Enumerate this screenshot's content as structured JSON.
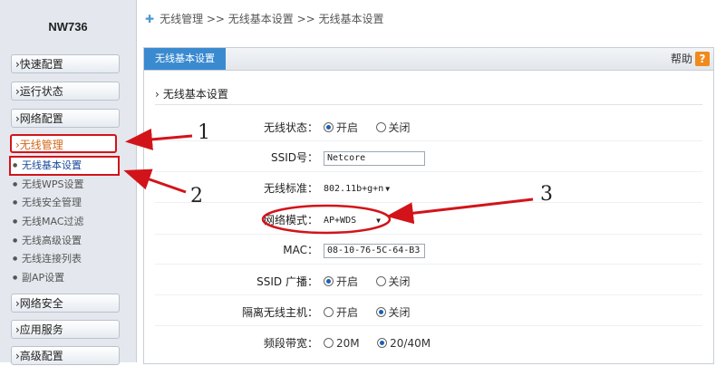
{
  "sidebar": {
    "model": "NW736",
    "nav": [
      {
        "label": "›快速配置"
      },
      {
        "label": "›运行状态"
      },
      {
        "label": "›网络配置"
      },
      {
        "label": "›无线管理"
      }
    ],
    "sub_items": [
      {
        "label": "无线基本设置"
      },
      {
        "label": "无线WPS设置"
      },
      {
        "label": "无线安全管理"
      },
      {
        "label": "无线MAC过滤"
      },
      {
        "label": "无线高级设置"
      },
      {
        "label": "无线连接列表"
      },
      {
        "label": "副AP设置"
      }
    ],
    "nav_bottom": [
      {
        "label": "›网络安全"
      },
      {
        "label": "›应用服务"
      },
      {
        "label": "›高级配置"
      }
    ]
  },
  "breadcrumb": "无线管理 >> 无线基本设置 >> 无线基本设置",
  "panel": {
    "tab_label": "无线基本设置",
    "help_label": "帮助",
    "help_icon": "?",
    "section_title": "无线基本设置"
  },
  "form": {
    "wireless_status": {
      "label": "无线状态：",
      "options": [
        "开启",
        "关闭"
      ],
      "selected": 0
    },
    "ssid": {
      "label": "SSID号：",
      "value": "Netcore"
    },
    "standard": {
      "label": "无线标准：",
      "value": "802.11b+g+n"
    },
    "mode": {
      "label": "网络模式：",
      "value": "AP+WDS"
    },
    "mac": {
      "label": "MAC：",
      "value": "08-10-76-5C-64-B3"
    },
    "ssid_broadcast": {
      "label": "SSID 广播：",
      "options": [
        "开启",
        "关闭"
      ],
      "selected": 0
    },
    "isolation": {
      "label": "隔离无线主机：",
      "options": [
        "开启",
        "关闭"
      ],
      "selected": 1
    },
    "bandwidth": {
      "label": "频段带宽：",
      "options": [
        "20M",
        "20/40M"
      ],
      "selected": 1
    }
  },
  "annotations": [
    "1",
    "2",
    "3"
  ],
  "colors": {
    "accent": "#3a8ad0",
    "annotation": "#d2141a",
    "help": "#f08a1c"
  }
}
